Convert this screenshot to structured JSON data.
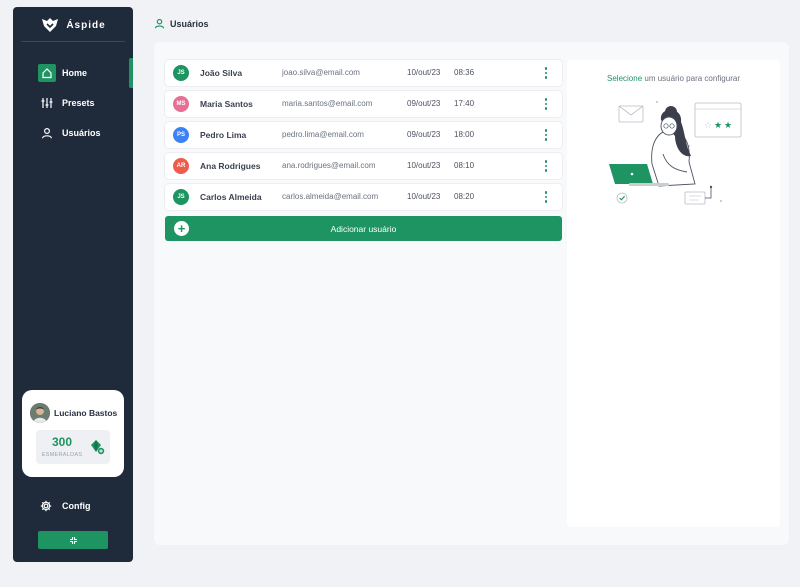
{
  "brand": {
    "name": "Áspide"
  },
  "sidebar": {
    "items": [
      {
        "label": "Home",
        "icon": "home-icon",
        "active": true
      },
      {
        "label": "Presets",
        "icon": "sliders-icon",
        "active": false
      },
      {
        "label": "Usuários",
        "icon": "user-icon",
        "active": false
      }
    ],
    "profile": {
      "name": "Luciano Bastos",
      "emeralds": "300",
      "emeralds_label": "ESMERALDAS"
    },
    "config_label": "Config",
    "collapse_icon": "collapse-icon"
  },
  "header": {
    "title": "Usuários"
  },
  "users": [
    {
      "initials": "JS",
      "name": "João Silva",
      "email": "joao.silva@email.com",
      "date": "10/out/23",
      "time": "08:36",
      "color": "#1d9462"
    },
    {
      "initials": "MS",
      "name": "Maria Santos",
      "email": "maria.santos@email.com",
      "date": "09/out/23",
      "time": "17:40",
      "color": "#e86f94"
    },
    {
      "initials": "PS",
      "name": "Pedro Lima",
      "email": "pedro.lima@email.com",
      "date": "09/out/23",
      "time": "18:00",
      "color": "#3b82f6"
    },
    {
      "initials": "AR",
      "name": "Ana Rodrigues",
      "email": "ana.rodrigues@email.com",
      "date": "10/out/23",
      "time": "08:10",
      "color": "#ef5b4c"
    },
    {
      "initials": "JS",
      "name": "Carlos Almeida",
      "email": "carlos.almeida@email.com",
      "date": "10/out/23",
      "time": "08:20",
      "color": "#1d9462"
    }
  ],
  "add_user_label": "Adicionar usuário",
  "config_panel": {
    "hint_accent": "Selecione",
    "hint_rest": " um usuário para configurar"
  },
  "colors": {
    "accent": "#1d9462",
    "sidebar": "#1f2a3b"
  }
}
